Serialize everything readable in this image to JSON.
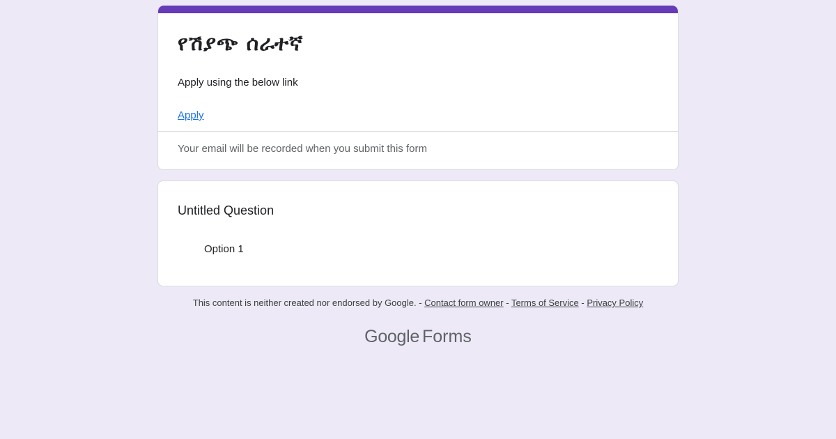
{
  "form": {
    "title": "የሽያጭ ሰራተኛ",
    "description": "Apply using the below link",
    "link_text": "Apply",
    "email_note": "Your email will be recorded when you submit this form",
    "accent_color": "#673ab7",
    "background_color": "#ede9f6"
  },
  "question": {
    "title": "Untitled Question",
    "options": [
      "Option 1"
    ]
  },
  "footer": {
    "disclaimer": "This content is neither created nor endorsed by Google.",
    "sep1": " - ",
    "contact_link": "Contact form owner",
    "sep2": " - ",
    "terms_link": "Terms of Service",
    "sep3": " - ",
    "privacy_link": "Privacy Policy"
  },
  "brand": {
    "google": "Google",
    "product": "Forms"
  }
}
